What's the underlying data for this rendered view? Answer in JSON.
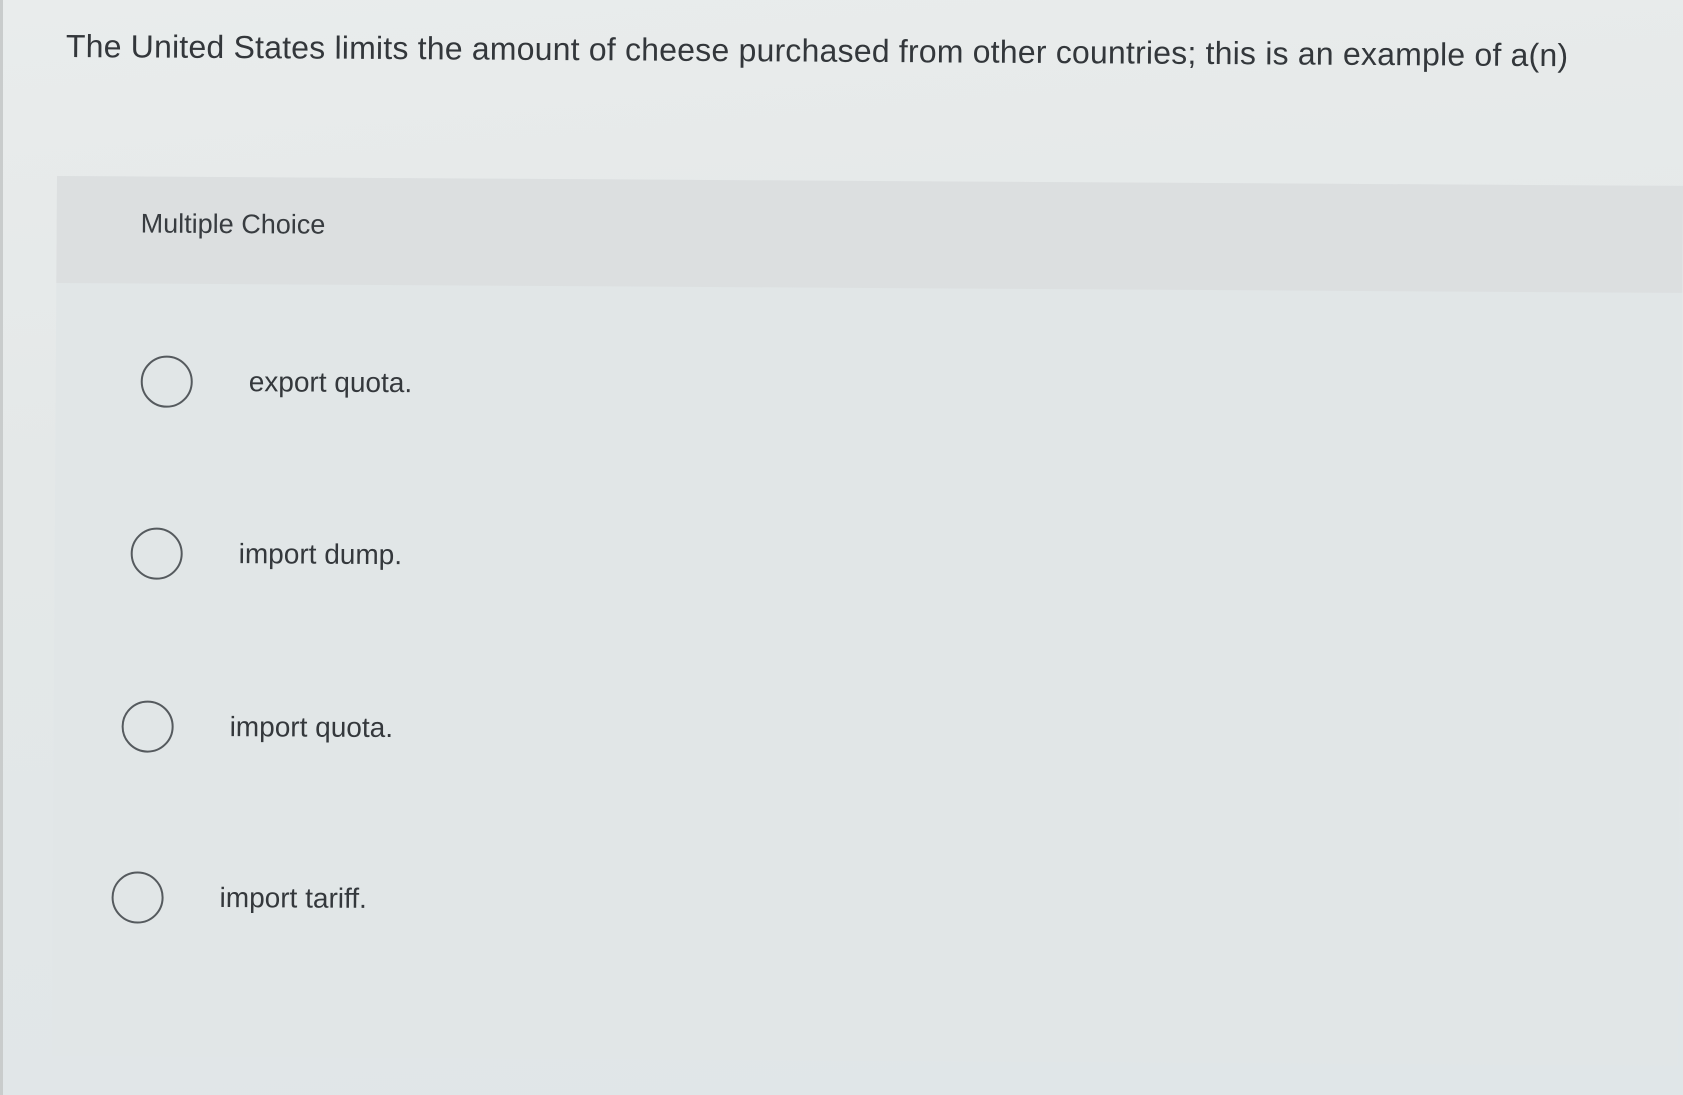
{
  "question": {
    "text": "The United States limits the amount of cheese purchased from other countries; this is an example of a(n)"
  },
  "card": {
    "header_label": "Multiple Choice",
    "options": [
      {
        "label": "export quota.",
        "selected": false
      },
      {
        "label": "import dump.",
        "selected": false
      },
      {
        "label": "import quota.",
        "selected": false
      },
      {
        "label": "import tariff.",
        "selected": false
      }
    ]
  }
}
